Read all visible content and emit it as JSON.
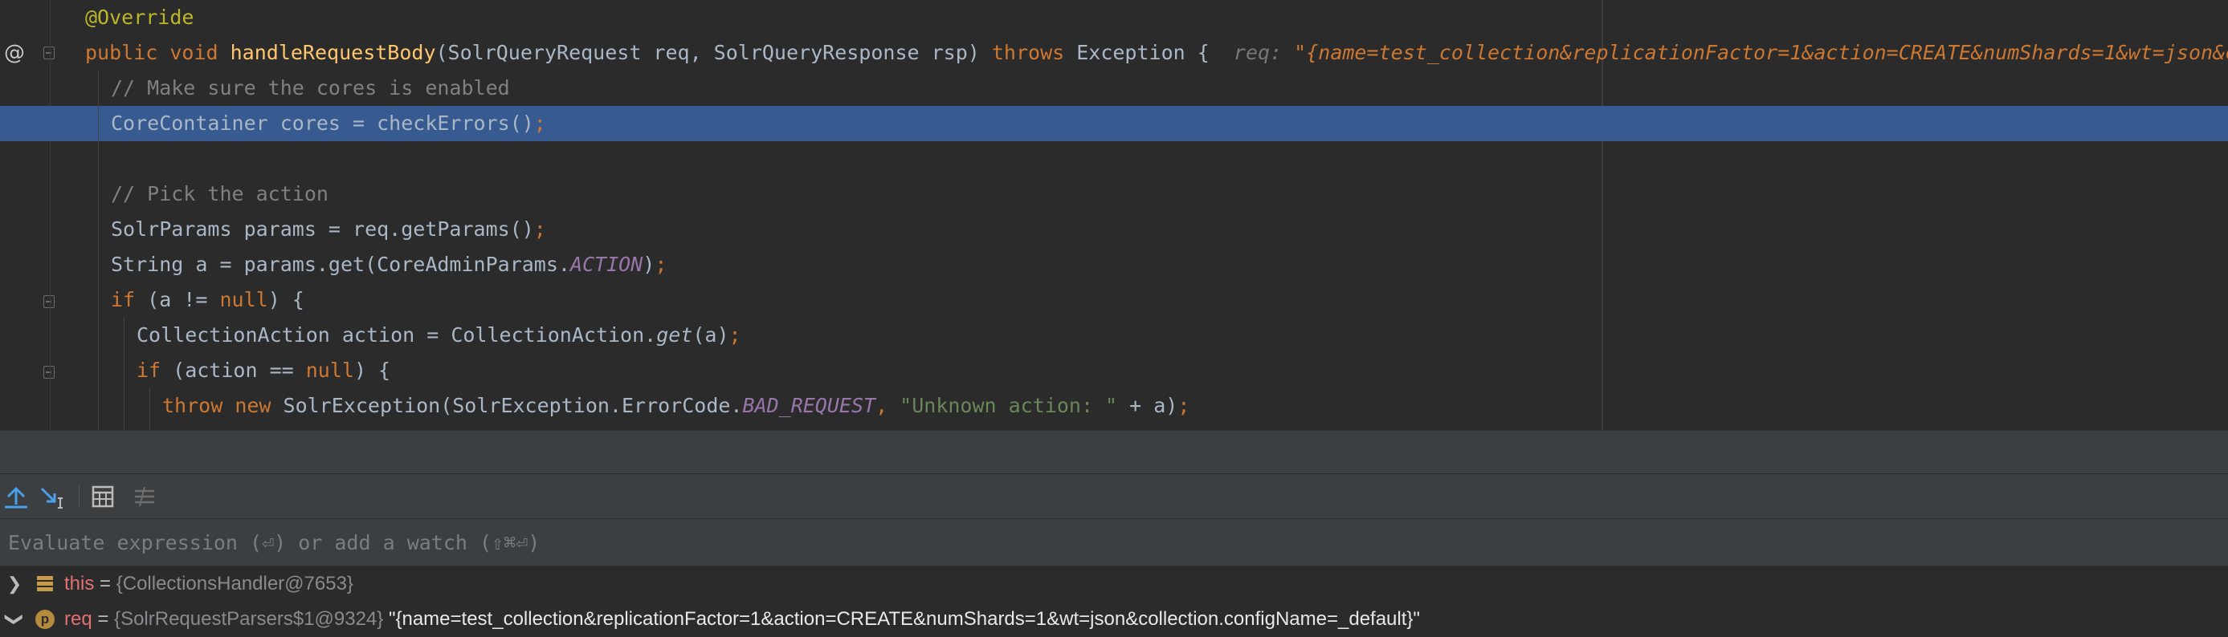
{
  "editor": {
    "lines": [
      {
        "segments": [
          {
            "t": "@Override",
            "c": "c-anno"
          }
        ]
      },
      {
        "segments": [
          {
            "t": "public ",
            "c": "c-kw"
          },
          {
            "t": "void ",
            "c": "c-kw"
          },
          {
            "t": "handleRequestBody",
            "c": "c-method"
          },
          {
            "t": "(SolrQueryRequest req, SolrQueryResponse rsp) ",
            "c": "c-plain"
          },
          {
            "t": "throws ",
            "c": "c-kw"
          },
          {
            "t": "Exception {",
            "c": "c-plain"
          }
        ],
        "inline_hint": {
          "name": "req: ",
          "value": "\"{name=test_collection&replicationFactor=1&action=CREATE&numShards=1&wt=json&collection.configName=_default}\""
        }
      },
      {
        "segments": [
          {
            "t": "// Make sure the cores is enabled",
            "c": "c-comment"
          }
        ]
      },
      {
        "segments": [
          {
            "t": "CoreContainer cores = checkErrors()",
            "c": "c-plain"
          },
          {
            "t": ";",
            "c": "sym-semi"
          }
        ]
      },
      {
        "segments": []
      },
      {
        "segments": [
          {
            "t": "// Pick the action",
            "c": "c-comment"
          }
        ]
      },
      {
        "segments": [
          {
            "t": "SolrParams params = req.getParams()",
            "c": "c-plain"
          },
          {
            "t": ";",
            "c": "c-kw"
          }
        ]
      },
      {
        "segments": [
          {
            "t": "String a = params.get(CoreAdminParams.",
            "c": "c-plain"
          },
          {
            "t": "ACTION",
            "c": "c-const"
          },
          {
            "t": ")",
            "c": "c-plain"
          },
          {
            "t": ";",
            "c": "c-kw"
          }
        ]
      },
      {
        "segments": [
          {
            "t": "if ",
            "c": "c-kw"
          },
          {
            "t": "(a != ",
            "c": "c-plain"
          },
          {
            "t": "null",
            "c": "c-kw"
          },
          {
            "t": ") {",
            "c": "c-plain"
          }
        ]
      },
      {
        "segments": [
          {
            "t": "CollectionAction action = CollectionAction.",
            "c": "c-plain"
          },
          {
            "t": "get",
            "c": "c-static"
          },
          {
            "t": "(a)",
            "c": "c-plain"
          },
          {
            "t": ";",
            "c": "c-kw"
          }
        ]
      },
      {
        "segments": [
          {
            "t": "if ",
            "c": "c-kw"
          },
          {
            "t": "(action == ",
            "c": "c-plain"
          },
          {
            "t": "null",
            "c": "c-kw"
          },
          {
            "t": ") {",
            "c": "c-plain"
          }
        ]
      },
      {
        "segments": [
          {
            "t": "throw ",
            "c": "c-kw"
          },
          {
            "t": "new ",
            "c": "c-kw"
          },
          {
            "t": "SolrException(SolrException.ErrorCode.",
            "c": "c-plain"
          },
          {
            "t": "BAD_REQUEST",
            "c": "c-const"
          },
          {
            "t": ", ",
            "c": "c-kw"
          },
          {
            "t": "\"Unknown action: \" ",
            "c": "c-str"
          },
          {
            "t": "+ a)",
            "c": "c-plain"
          },
          {
            "t": ";",
            "c": "c-kw"
          }
        ]
      }
    ]
  },
  "debugger": {
    "toolbar_icons": [
      "step-out-icon",
      "run-to-cursor-icon",
      "evaluate-icon",
      "trace-icon"
    ],
    "evaluate_placeholder": "Evaluate expression (⏎) or add a watch (⇧⌘⏎)",
    "evaluate_value": "",
    "variables": [
      {
        "expanded": false,
        "icon": "fields-icon",
        "name": "this",
        "eq": " = ",
        "type": "{CollectionsHandler@7653}",
        "value": ""
      },
      {
        "expanded": true,
        "icon": "parameter-icon",
        "icon_letter": "p",
        "name": "req",
        "eq": " = ",
        "type": "{SolrRequestParsers$1@9324} ",
        "value": "\"{name=test_collection&replicationFactor=1&action=CREATE&numShards=1&wt=json&collection.configName=_default}\""
      }
    ]
  },
  "colors": {
    "editor_bg": "#2b2b2b",
    "highlight": "#375a91",
    "keyword": "#cc7832",
    "method": "#ffc66d",
    "annotation": "#bbb529",
    "comment": "#808080",
    "string": "#6a8759",
    "constant": "#9876aa",
    "panel_bg": "#3c3f41",
    "breakpoint": "#c75450"
  }
}
